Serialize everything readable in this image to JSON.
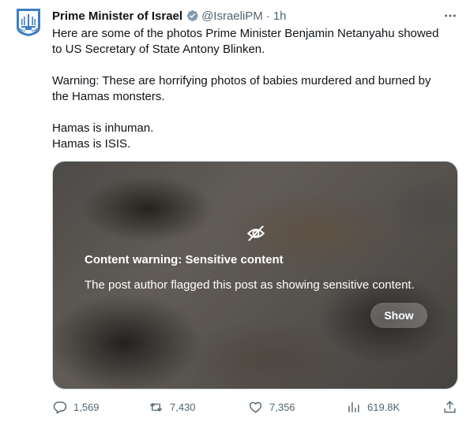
{
  "post": {
    "author_name": "Prime Minister of Israel",
    "handle": "@IsraeliPM",
    "separator": "·",
    "time": "1h",
    "more_label": "···",
    "text_lines": [
      "Here are some of the photos Prime Minister Benjamin Netanyahu showed",
      "to US Secretary of State Antony Blinken.",
      "Warning: These are horrifying photos of babies murdered and burned by",
      "the Hamas monsters.",
      "Hamas is inhuman.",
      "Hamas is ISIS."
    ]
  },
  "media": {
    "warning_title": "Content warning: Sensitive content",
    "warning_description": "The post author flagged this post as showing sensitive content.",
    "show_label": "Show"
  },
  "actions": {
    "replies": "1,569",
    "reposts": "7,430",
    "likes": "7,356",
    "views": "619.8K"
  },
  "icons": {
    "avatar": "israel-emblem-icon",
    "verified": "verified-badge-icon",
    "sensitive": "eye-off-icon",
    "reply": "reply-icon",
    "repost": "repost-icon",
    "like": "heart-icon",
    "views": "views-chart-icon",
    "share": "share-icon"
  },
  "colors": {
    "text_primary": "#0f1419",
    "text_secondary": "#536471",
    "verified_badge": "#829aab",
    "emblem_blue": "#3d7fc7"
  }
}
